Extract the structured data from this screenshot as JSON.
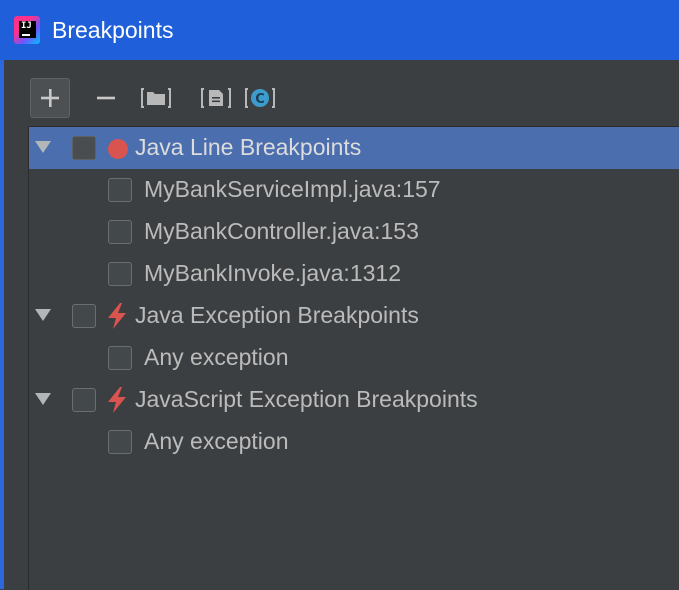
{
  "window": {
    "title": "Breakpoints",
    "app_icon_text": "IJ"
  },
  "colors": {
    "titlebar": "#1f5fd9",
    "background": "#3c3f41",
    "selection": "#4b6eaf",
    "breakpoint_red": "#d9534f"
  },
  "toolbar": {
    "buttons": [
      {
        "name": "add",
        "icon": "plus-icon"
      },
      {
        "name": "remove",
        "icon": "minus-icon"
      },
      {
        "name": "group-by-package",
        "icon": "folder-icon"
      },
      {
        "name": "group-by-file",
        "icon": "file-icon"
      },
      {
        "name": "group-by-class",
        "icon": "class-icon",
        "glyph": "C"
      }
    ]
  },
  "tree": {
    "groups": [
      {
        "label": "Java Line Breakpoints",
        "icon": "breakpoint-dot-icon",
        "selected": true,
        "children": [
          {
            "label": "MyBankServiceImpl.java:157"
          },
          {
            "label": "MyBankController.java:153"
          },
          {
            "label": "MyBankInvoke.java:1312"
          }
        ]
      },
      {
        "label": "Java Exception Breakpoints",
        "icon": "lightning-icon",
        "children": [
          {
            "label": "Any exception"
          }
        ]
      },
      {
        "label": "JavaScript Exception Breakpoints",
        "icon": "lightning-icon",
        "children": [
          {
            "label": "Any exception"
          }
        ]
      }
    ]
  }
}
